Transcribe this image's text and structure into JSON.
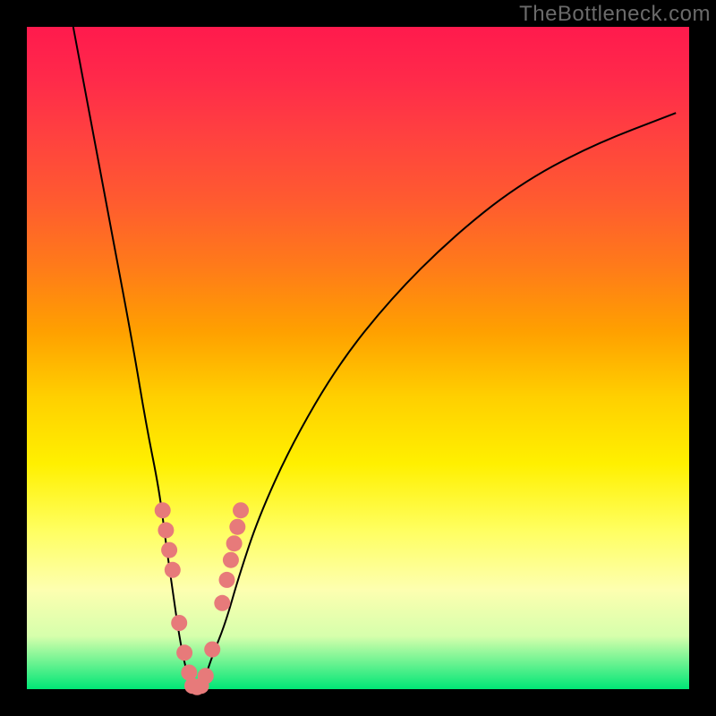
{
  "watermark": "TheBottleneck.com",
  "chart_data": {
    "type": "line",
    "title": "",
    "xlabel": "",
    "ylabel": "",
    "xlim": [
      0,
      100
    ],
    "ylim": [
      0,
      100
    ],
    "grid": false,
    "legend": false,
    "curve": {
      "comment": "V-shaped bottleneck curve; x is normalized 0-100 left→right, y is 0 at bottom → 100 at top",
      "x": [
        7,
        10,
        13,
        16,
        18,
        20,
        21,
        22,
        23,
        24,
        25,
        26,
        27,
        28,
        30,
        32,
        35,
        40,
        47,
        55,
        64,
        74,
        85,
        98
      ],
      "y": [
        100,
        84,
        68,
        52,
        40,
        30,
        22,
        15,
        8,
        3,
        0,
        0,
        2,
        5,
        10,
        17,
        26,
        37,
        49,
        59,
        68,
        76,
        82,
        87
      ]
    },
    "points": {
      "comment": "highlighted sample markers along the curve near the valley",
      "x": [
        20.5,
        21.0,
        21.5,
        22.0,
        23.0,
        23.8,
        24.5,
        25.0,
        25.7,
        26.3,
        27.0,
        28.0,
        29.5,
        30.2,
        30.8,
        31.3,
        31.8,
        32.3
      ],
      "y": [
        27.0,
        24.0,
        21.0,
        18.0,
        10.0,
        5.5,
        2.5,
        0.5,
        0.3,
        0.5,
        2.0,
        6.0,
        13.0,
        16.5,
        19.5,
        22.0,
        24.5,
        27.0
      ]
    },
    "background_gradient": {
      "top": "#ff1a4d",
      "mid": "#ffe000",
      "bottom": "#00e676"
    }
  }
}
